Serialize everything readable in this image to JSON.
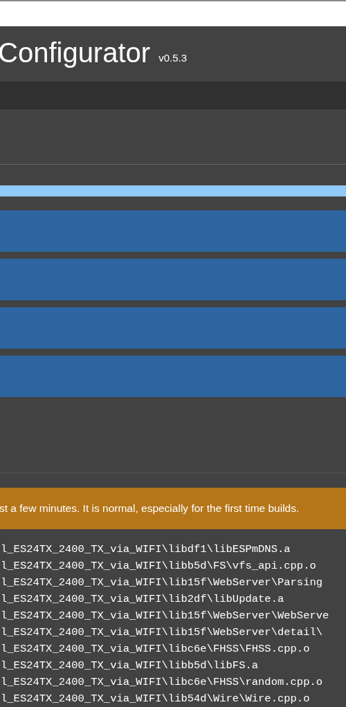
{
  "header": {
    "title": "Configurator",
    "version": "v0.5.3"
  },
  "progress": {
    "level": 1
  },
  "buttons": [
    {
      "kind": "blank"
    },
    {
      "kind": "blank"
    },
    {
      "kind": "blank"
    },
    {
      "kind": "blank"
    }
  ],
  "notice": {
    "text": "st a few minutes. It is normal, especially for the first time builds."
  },
  "log": [
    "l_ES24TX_2400_TX_via_WIFI\\libdf1\\libESPmDNS.a",
    "l_ES24TX_2400_TX_via_WIFI\\libb5d\\FS\\vfs_api.cpp.o",
    "l_ES24TX_2400_TX_via_WIFI\\lib15f\\WebServer\\Parsing",
    "l_ES24TX_2400_TX_via_WIFI\\lib2df\\libUpdate.a",
    "l_ES24TX_2400_TX_via_WIFI\\lib15f\\WebServer\\WebServe",
    "l_ES24TX_2400_TX_via_WIFI\\lib15f\\WebServer\\detail\\",
    "l_ES24TX_2400_TX_via_WIFI\\libc6e\\FHSS\\FHSS.cpp.o",
    "l_ES24TX_2400_TX_via_WIFI\\libb5d\\libFS.a",
    "l_ES24TX_2400_TX_via_WIFI\\libc6e\\FHSS\\random.cpp.o",
    "l_ES24TX_2400_TX_via_WIFI\\lib54d\\Wire\\Wire.cpp.o"
  ]
}
